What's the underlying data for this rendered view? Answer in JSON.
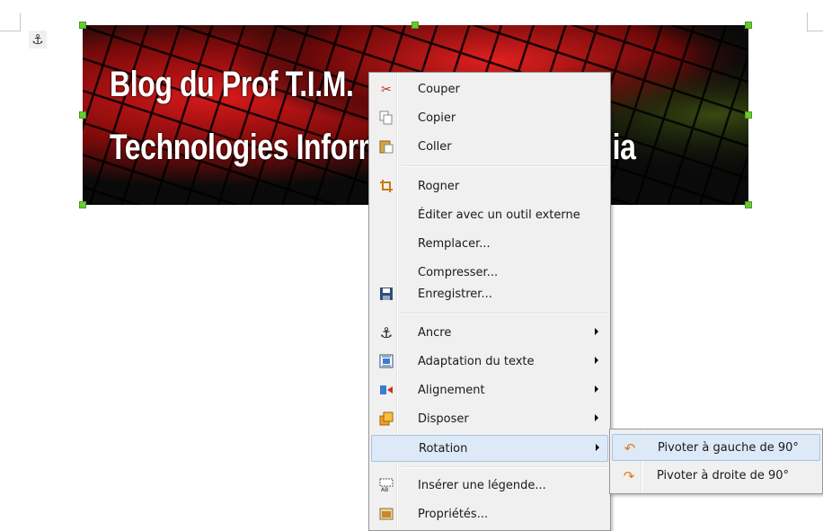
{
  "image": {
    "line1": "Blog du Prof T.I.M.",
    "line2": "Technologies Informatiques Multimédia"
  },
  "icons": {
    "anchor_marker": "anchor-icon"
  },
  "context_menu": {
    "items": [
      {
        "label": "Couper",
        "icon": "scissors-icon"
      },
      {
        "label": "Copier",
        "icon": "copy-icon"
      },
      {
        "label": "Coller",
        "icon": "paste-icon"
      },
      {
        "label": "Rogner",
        "icon": "crop-icon"
      },
      {
        "label": "Éditer avec un outil externe",
        "icon": ""
      },
      {
        "label": "Remplacer...",
        "icon": ""
      },
      {
        "label": "Compresser...",
        "icon": ""
      },
      {
        "label": "Enregistrer...",
        "icon": "save-icon"
      },
      {
        "label": "Ancre",
        "icon": "anchor-icon",
        "submenu": true
      },
      {
        "label": "Adaptation du texte",
        "icon": "wrap-icon",
        "submenu": true
      },
      {
        "label": "Alignement",
        "icon": "align-icon",
        "submenu": true
      },
      {
        "label": "Disposer",
        "icon": "arrange-icon",
        "submenu": true
      },
      {
        "label": "Rotation",
        "icon": "",
        "submenu": true,
        "highlighted": true
      },
      {
        "label": "Insérer une légende...",
        "icon": "caption-icon"
      },
      {
        "label": "Propriétés...",
        "icon": "properties-icon"
      }
    ]
  },
  "rotation_submenu": {
    "items": [
      {
        "label": "Pivoter à gauche de 90°",
        "icon": "rotate-left-icon"
      },
      {
        "label": "Pivoter à droite de 90°",
        "icon": "rotate-right-icon"
      }
    ]
  },
  "colors": {
    "handle": "#66cc33",
    "menu_bg": "#f0f0f0",
    "highlight": "#dde9f7",
    "rotate_icon": "#e07a10"
  }
}
